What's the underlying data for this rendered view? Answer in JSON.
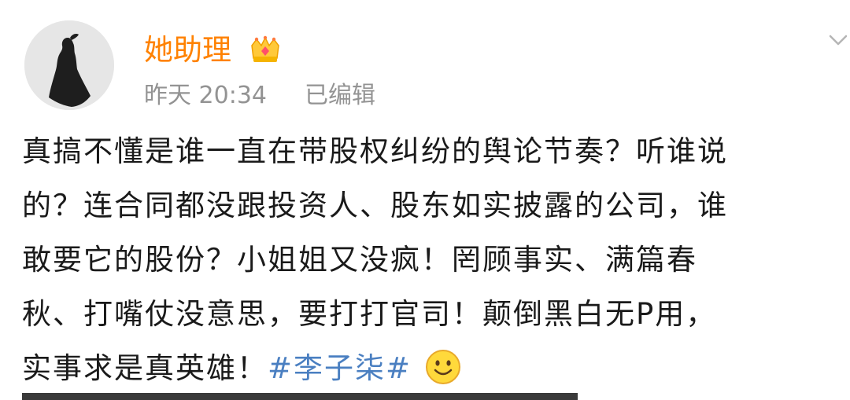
{
  "author": {
    "name": "她助理",
    "badge_icon": "vip-crown-icon",
    "name_color": "#ff8200"
  },
  "meta": {
    "timestamp": "昨天 20:34",
    "edited": "已编辑"
  },
  "menu": {
    "icon": "chevron-down-icon"
  },
  "post": {
    "lines": [
      "真搞不懂是谁一直在带股权纠纷的舆论节奏？听谁说",
      "的？连合同都没跟投资人、股东如实披露的公司，谁",
      "敢要它的股份？小姐姐又没疯！罔顾事实、满篇春",
      "秋、打嘴仗没意思，要打打官司！颠倒黑白无P用，"
    ],
    "last_line_text": "实事求是真英雄！",
    "hashtag": "#李子柒#",
    "emoji": "smile-emoji-icon",
    "hashtag_color": "#4a7fc1"
  }
}
